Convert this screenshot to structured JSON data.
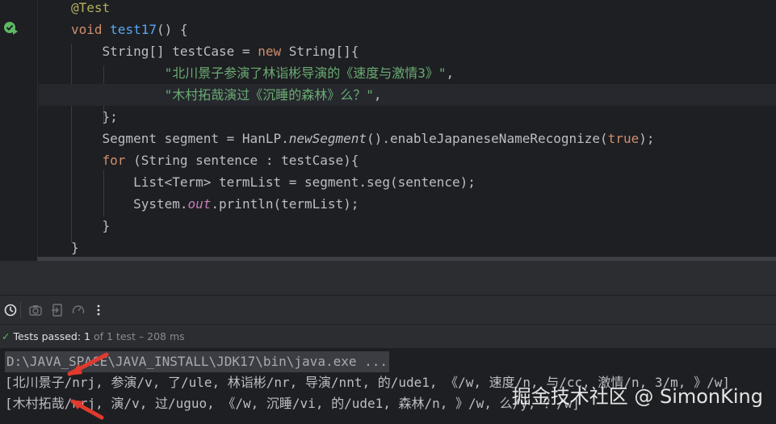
{
  "editor": {
    "lines": [
      {
        "tokens": [
          {
            "t": "@Test",
            "c": "an"
          }
        ]
      },
      {
        "tokens": [
          {
            "t": "void ",
            "c": "kw"
          },
          {
            "t": "test17",
            "c": "fn"
          },
          {
            "t": "() {",
            "c": ""
          }
        ]
      },
      {
        "tokens": [
          {
            "t": "    String[] testCase = ",
            "c": ""
          },
          {
            "t": "new ",
            "c": "kw"
          },
          {
            "t": "String[]{",
            "c": ""
          }
        ]
      },
      {
        "tokens": [
          {
            "t": "            ",
            "c": ""
          },
          {
            "t": "\"北川景子参演了林诣彬导演的《速度与激情3》\"",
            "c": "str"
          },
          {
            "t": ",",
            "c": ""
          }
        ]
      },
      {
        "tokens": [
          {
            "t": "            ",
            "c": ""
          },
          {
            "t": "\"木村拓哉演过《沉睡的森林》么？\"",
            "c": "str"
          },
          {
            "t": ",",
            "c": ""
          }
        ]
      },
      {
        "tokens": [
          {
            "t": "    };",
            "c": ""
          }
        ]
      },
      {
        "tokens": [
          {
            "t": "    Segment segment = HanLP.",
            "c": ""
          },
          {
            "t": "newSegment",
            "c": "it"
          },
          {
            "t": "().enableJapaneseNameRecognize(",
            "c": ""
          },
          {
            "t": "true",
            "c": "kw"
          },
          {
            "t": ");",
            "c": ""
          }
        ]
      },
      {
        "tokens": [
          {
            "t": "    ",
            "c": ""
          },
          {
            "t": "for ",
            "c": "kw"
          },
          {
            "t": "(String sentence : testCase){",
            "c": ""
          }
        ]
      },
      {
        "tokens": [
          {
            "t": "        List<Term> termList = segment.seg(sentence);",
            "c": ""
          }
        ]
      },
      {
        "tokens": [
          {
            "t": "        System.",
            "c": ""
          },
          {
            "t": "out",
            "c": "static"
          },
          {
            "t": ".println(termList);",
            "c": ""
          }
        ]
      },
      {
        "tokens": [
          {
            "t": "    }",
            "c": ""
          }
        ]
      },
      {
        "tokens": [
          {
            "t": "}",
            "c": ""
          }
        ]
      }
    ]
  },
  "toolbar": {
    "icons": [
      "clock-icon",
      "camera-icon",
      "import-icon",
      "gauge-icon",
      "more-vertical-icon"
    ]
  },
  "status": {
    "label": "Tests passed:",
    "passed": "1",
    "detail": "of 1 test – 208 ms"
  },
  "console": {
    "command": "D:\\JAVA_SPACE\\JAVA_INSTALL\\JDK17\\bin\\java.exe ...",
    "output": [
      "[北川景子/nrj, 参演/v, 了/ule, 林诣彬/nr, 导演/nnt, 的/ude1, 《/w, 速度/n, 与/cc, 激情/n, 3/m, 》/w]",
      "[木村拓哉/nrj, 演/v, 过/uguo, 《/w, 沉睡/vi, 的/ude1, 森林/n, 》/w, 么/y, ？/w]"
    ]
  },
  "watermark": "掘金技术社区 @ SimonKing",
  "colors": {
    "background": "#1e1f22",
    "keyword": "#cf8e6d",
    "function": "#56a8f5",
    "string": "#6aab73",
    "annotation": "#b3ae60",
    "pass": "#5fb865",
    "arrow": "#e03a2e"
  }
}
